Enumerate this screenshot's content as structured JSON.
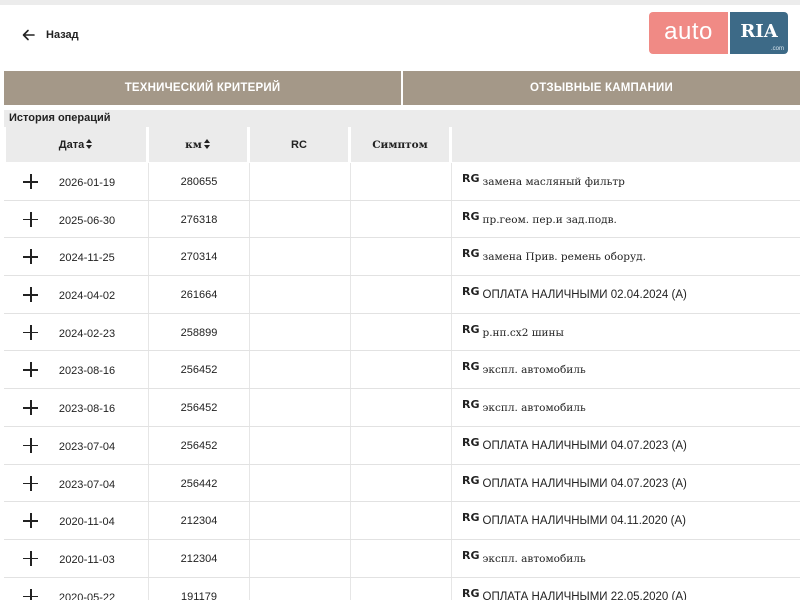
{
  "header": {
    "back_label": "Назад",
    "logo": {
      "auto": "auto",
      "ria": "RIA",
      "com": ".com"
    }
  },
  "tabs": [
    {
      "label": "ТЕХНИЧЕСКИЙ КРИТЕРИЙ"
    },
    {
      "label": "ОТЗЫВНЫЕ КАМПАНИИ"
    }
  ],
  "section_title": "История операций",
  "columns": {
    "date": "Дата",
    "km": "км",
    "rc": "RC",
    "symptom": "Симптом",
    "desc": ""
  },
  "rows": [
    {
      "date": "2026-01-19",
      "km": "280655",
      "badge": "RG",
      "desc": "замена масляный фильтр",
      "serif": true
    },
    {
      "date": "2025-06-30",
      "km": "276318",
      "badge": "RG",
      "desc": "пр.геом. пер.и зад.подв.",
      "serif": true
    },
    {
      "date": "2024-11-25",
      "km": "270314",
      "badge": "RG",
      "desc": "замена Прив. ремень оборуд.",
      "serif": true
    },
    {
      "date": "2024-04-02",
      "km": "261664",
      "badge": "RG",
      "desc": "ОПЛАТА НАЛИЧНЫМИ 02.04.2024 (A)",
      "serif": false
    },
    {
      "date": "2024-02-23",
      "km": "258899",
      "badge": "RG",
      "desc": "р.нп.сх2 шины",
      "serif": true
    },
    {
      "date": "2023-08-16",
      "km": "256452",
      "badge": "RG",
      "desc": "экспл. автомобиль",
      "serif": true
    },
    {
      "date": "2023-08-16",
      "km": "256452",
      "badge": "RG",
      "desc": "экспл. автомобиль",
      "serif": true
    },
    {
      "date": "2023-07-04",
      "km": "256452",
      "badge": "RG",
      "desc": "ОПЛАТА НАЛИЧНЫМИ 04.07.2023 (A)",
      "serif": false
    },
    {
      "date": "2023-07-04",
      "km": "256442",
      "badge": "RG",
      "desc": "ОПЛАТА НАЛИЧНЫМИ 04.07.2023 (A)",
      "serif": false
    },
    {
      "date": "2020-11-04",
      "km": "212304",
      "badge": "RG",
      "desc": "ОПЛАТА НАЛИЧНЫМИ 04.11.2020 (A)",
      "serif": false
    },
    {
      "date": "2020-11-03",
      "km": "212304",
      "badge": "RG",
      "desc": "экспл. автомобиль",
      "serif": true
    },
    {
      "date": "2020-05-22",
      "km": "191179",
      "badge": "RG",
      "desc": "ОПЛАТА НАЛИЧНЫМИ 22.05.2020 (A)",
      "serif": false
    }
  ]
}
